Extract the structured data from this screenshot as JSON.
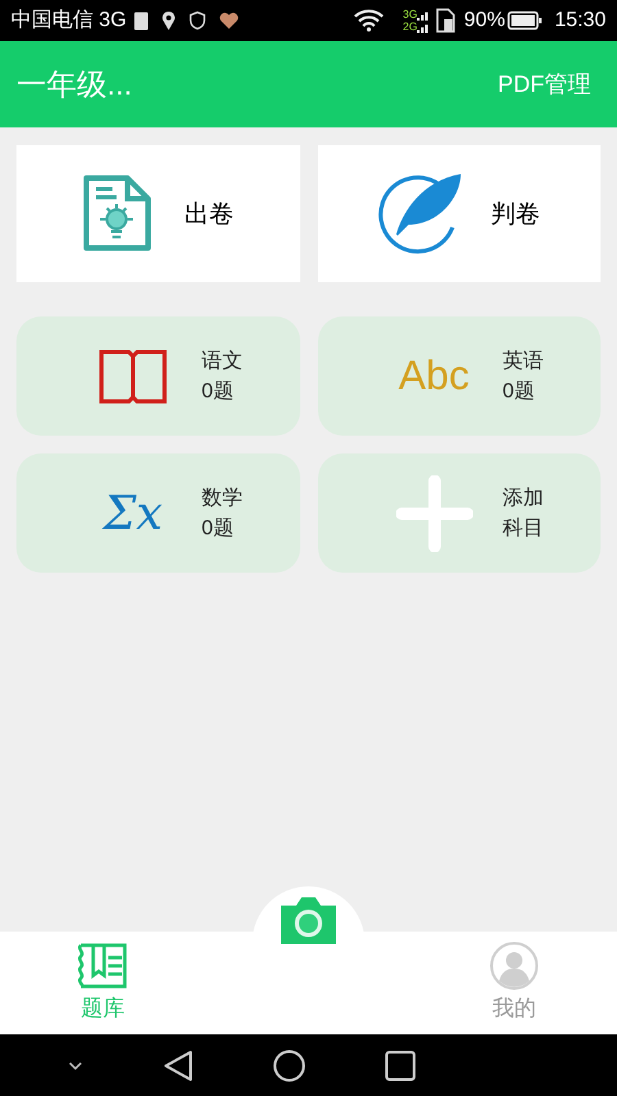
{
  "status_bar": {
    "carrier": "中国电信 3G",
    "network_top": "3G",
    "network_bottom": "2G",
    "battery": "90%",
    "time": "15:30"
  },
  "app_bar": {
    "title": "一年级...",
    "action": "PDF管理"
  },
  "actions": [
    {
      "kind": "make",
      "label": "出卷"
    },
    {
      "kind": "grade",
      "label": "判卷"
    }
  ],
  "subjects": [
    {
      "kind": "book",
      "name": "语文",
      "count": "0题"
    },
    {
      "kind": "letters",
      "icon_text": "Abc",
      "name": "英语",
      "count": "0题"
    },
    {
      "kind": "sigma",
      "icon_text": "Σx",
      "name": "数学",
      "count": "0题"
    },
    {
      "kind": "add",
      "name": "添加",
      "count": "科目"
    }
  ],
  "tabs": [
    {
      "kind": "bank",
      "label": "题库",
      "selected": true
    },
    {
      "kind": "camera"
    },
    {
      "kind": "me",
      "label": "我的",
      "selected": false
    }
  ]
}
